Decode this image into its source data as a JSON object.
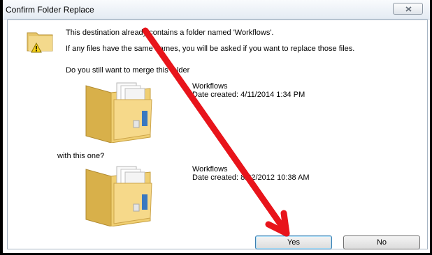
{
  "dialog": {
    "title": "Confirm Folder Replace",
    "message": "This destination already contains a folder named 'Workflows'.",
    "detail": "If any files have the same names, you will be asked if you want to replace those files.",
    "question": "Do you still want to merge this folder",
    "with_label": "with this one?",
    "source": {
      "name": "Workflows",
      "date": "Date created: 4/11/2014 1:34 PM"
    },
    "destination": {
      "name": "Workflows",
      "date": "Date created: 8/22/2012 10:38 AM"
    },
    "buttons": {
      "yes": "Yes",
      "no": "No"
    }
  },
  "icons": {
    "warning": "warning-folder-icon",
    "folder": "folder-icon",
    "close": "close-icon",
    "arrow": "annotation-arrow"
  },
  "colors": {
    "arrow": "#e8141b",
    "titlebar": "#e4ebf3",
    "folder": "#f3d27a"
  }
}
